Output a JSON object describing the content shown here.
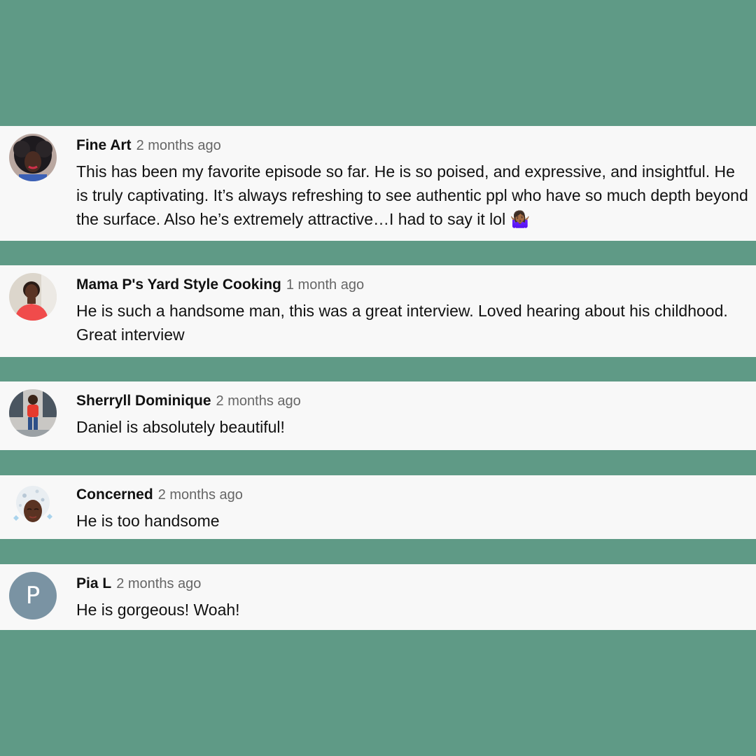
{
  "comments": [
    {
      "author": "Fine Art",
      "time": "2 months ago",
      "text": "This has been my favorite episode so far. He is so poised, and expressive, and insightful. He is truly captivating. It’s always refreshing to see authentic ppl who have so much depth beyond the surface. Also he’s extremely attractive…I had to say it lol 🤷🏾‍♀️",
      "avatar_icon": "user-photo-curly-hair-icon"
    },
    {
      "author": "Mama P's Yard Style Cooking",
      "time": "1 month ago",
      "text": "He is such a handsome man, this was a great interview. Loved hearing about his childhood. Great interview",
      "avatar_icon": "user-photo-red-top-icon"
    },
    {
      "author": "Sherryll Dominique",
      "time": "2 months ago",
      "text": "Daniel is absolutely beautiful!",
      "avatar_icon": "user-photo-standing-icon"
    },
    {
      "author": "Concerned",
      "time": "2 months ago",
      "text": "He is too handsome",
      "avatar_icon": "user-illustration-icon"
    },
    {
      "author": "Pia L",
      "time": "2 months ago",
      "text": "He is gorgeous! Woah!",
      "avatar_letter": "P",
      "avatar_color": "#7a93a3"
    }
  ],
  "colors": {
    "background": "#5f9a86",
    "card": "#f8f8f8",
    "author": "#111111",
    "timestamp": "#666666"
  }
}
